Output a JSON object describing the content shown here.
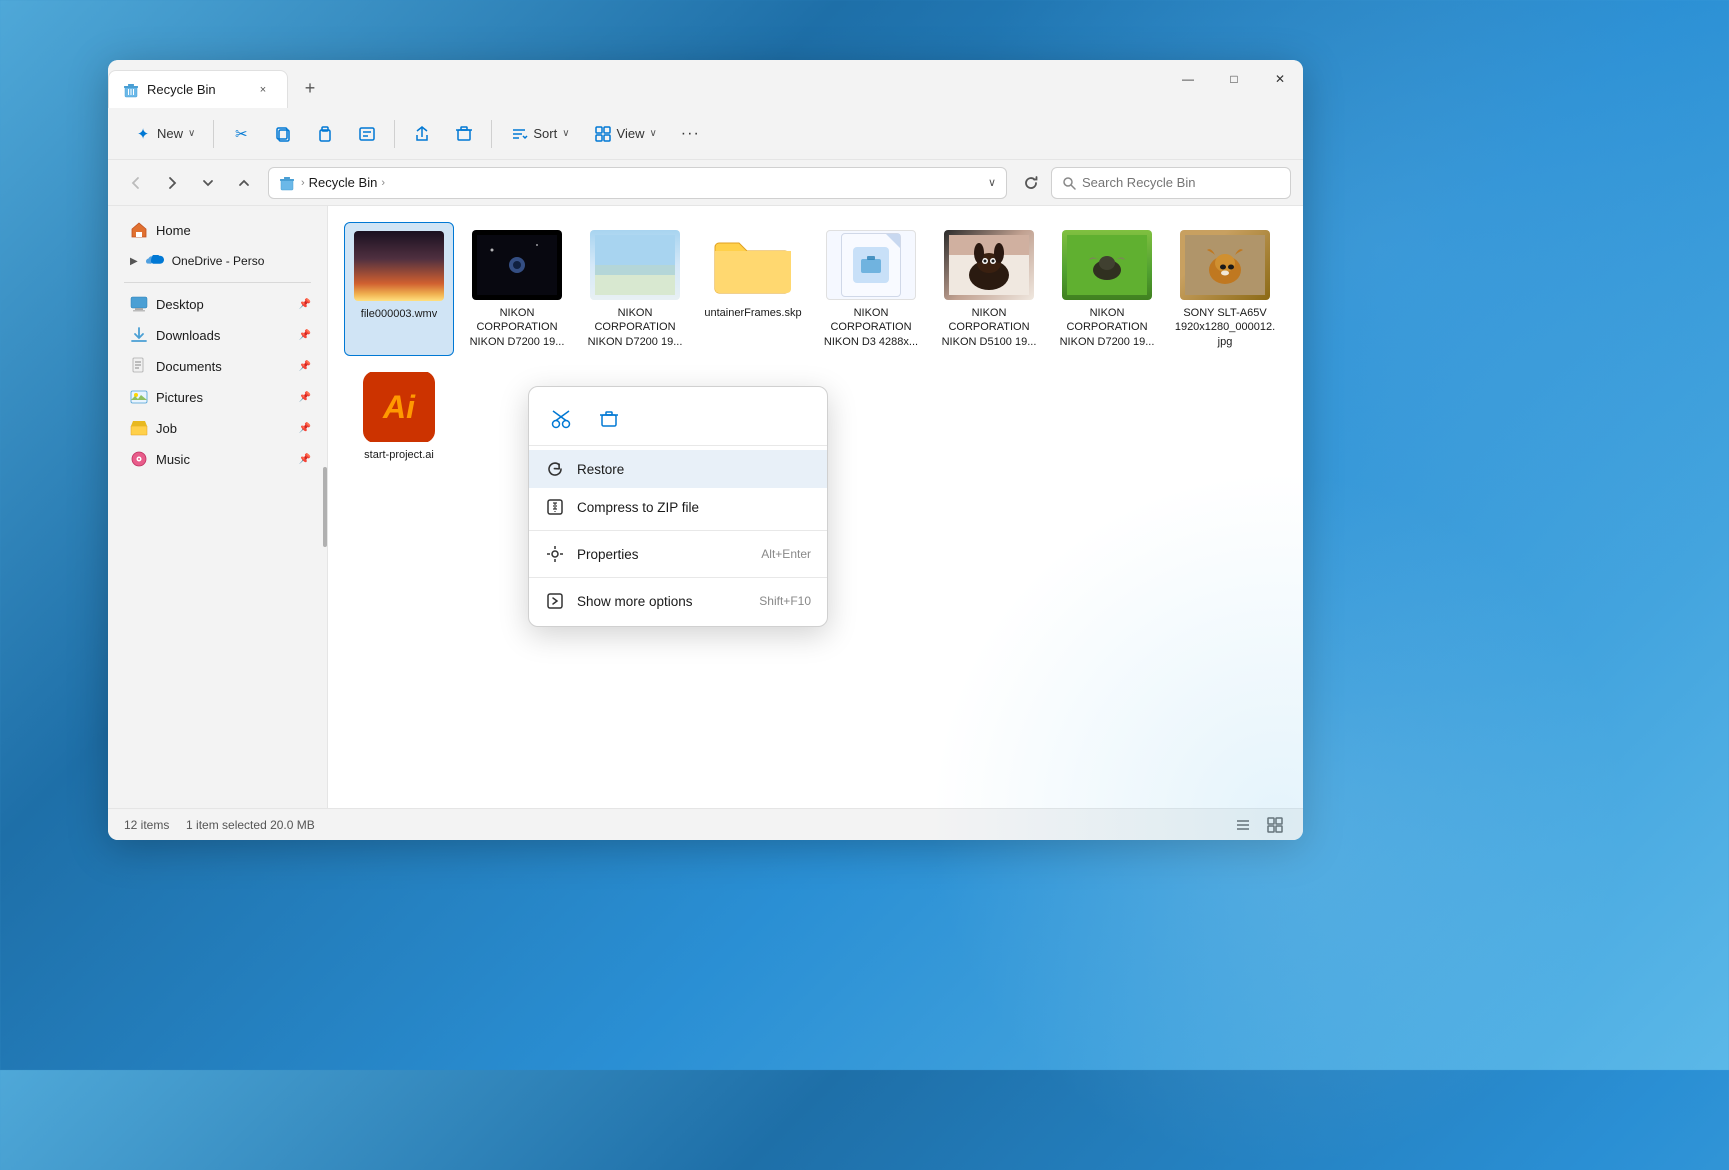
{
  "window": {
    "title": "Recycle Bin"
  },
  "titlebar": {
    "tab_label": "Recycle Bin",
    "tab_close": "×",
    "add_tab": "+",
    "minimize": "—",
    "maximize": "□",
    "close": "✕"
  },
  "toolbar": {
    "new_label": "New",
    "new_chevron": "∨",
    "cut_title": "Cut",
    "copy_title": "Copy",
    "paste_title": "Paste",
    "rename_title": "Rename",
    "share_title": "Share",
    "delete_title": "Delete",
    "sort_label": "Sort",
    "sort_chevron": "∨",
    "view_label": "View",
    "view_chevron": "∨",
    "more_label": "···"
  },
  "navbar": {
    "back_title": "Back",
    "forward_title": "Forward",
    "recent_title": "Recent locations",
    "up_title": "Up",
    "breadcrumb_arrow": "›",
    "breadcrumb_path": "Recycle Bin",
    "breadcrumb_chevron": "∨",
    "refresh_title": "Refresh",
    "search_placeholder": "Search Recycle Bin"
  },
  "sidebar": {
    "home_label": "Home",
    "onedrive_label": "OneDrive - Perso",
    "desktop_label": "Desktop",
    "downloads_label": "Downloads",
    "documents_label": "Documents",
    "pictures_label": "Pictures",
    "job_label": "Job",
    "music_label": "Music"
  },
  "files": [
    {
      "name": "file000003.wmv",
      "type": "video",
      "thumb": "sunset"
    },
    {
      "name": "NIKON CORPORATION NIKON D7200 19...",
      "type": "image",
      "thumb": "space"
    },
    {
      "name": "NIKON CORPORATION NIKON D7200 19...",
      "type": "image",
      "thumb": "sky"
    },
    {
      "name": "untainerFrames.skp",
      "type": "skp",
      "thumb": "folder"
    },
    {
      "name": "NIKON CORPORATION NIKON D3 4288x...",
      "type": "image",
      "thumb": "doc"
    },
    {
      "name": "NIKON CORPORATION NIKON D5100 19...",
      "type": "image",
      "thumb": "dog"
    },
    {
      "name": "NIKON CORPORATION NIKON D7200 19...",
      "type": "image",
      "thumb": "bird"
    },
    {
      "name": "SONY SLT-A65V 1920x1280_000012.jpg",
      "type": "image",
      "thumb": "fox"
    },
    {
      "name": "start-project.ai",
      "type": "ai",
      "thumb": "ai"
    }
  ],
  "context_menu": {
    "cut_label": "Cut",
    "delete_label": "Delete",
    "restore_label": "Restore",
    "compress_label": "Compress to ZIP file",
    "properties_label": "Properties",
    "properties_shortcut": "Alt+Enter",
    "more_options_label": "Show more options",
    "more_options_shortcut": "Shift+F10"
  },
  "statusbar": {
    "items_count": "12 items",
    "selected_info": "1 item selected  20.0 MB"
  }
}
